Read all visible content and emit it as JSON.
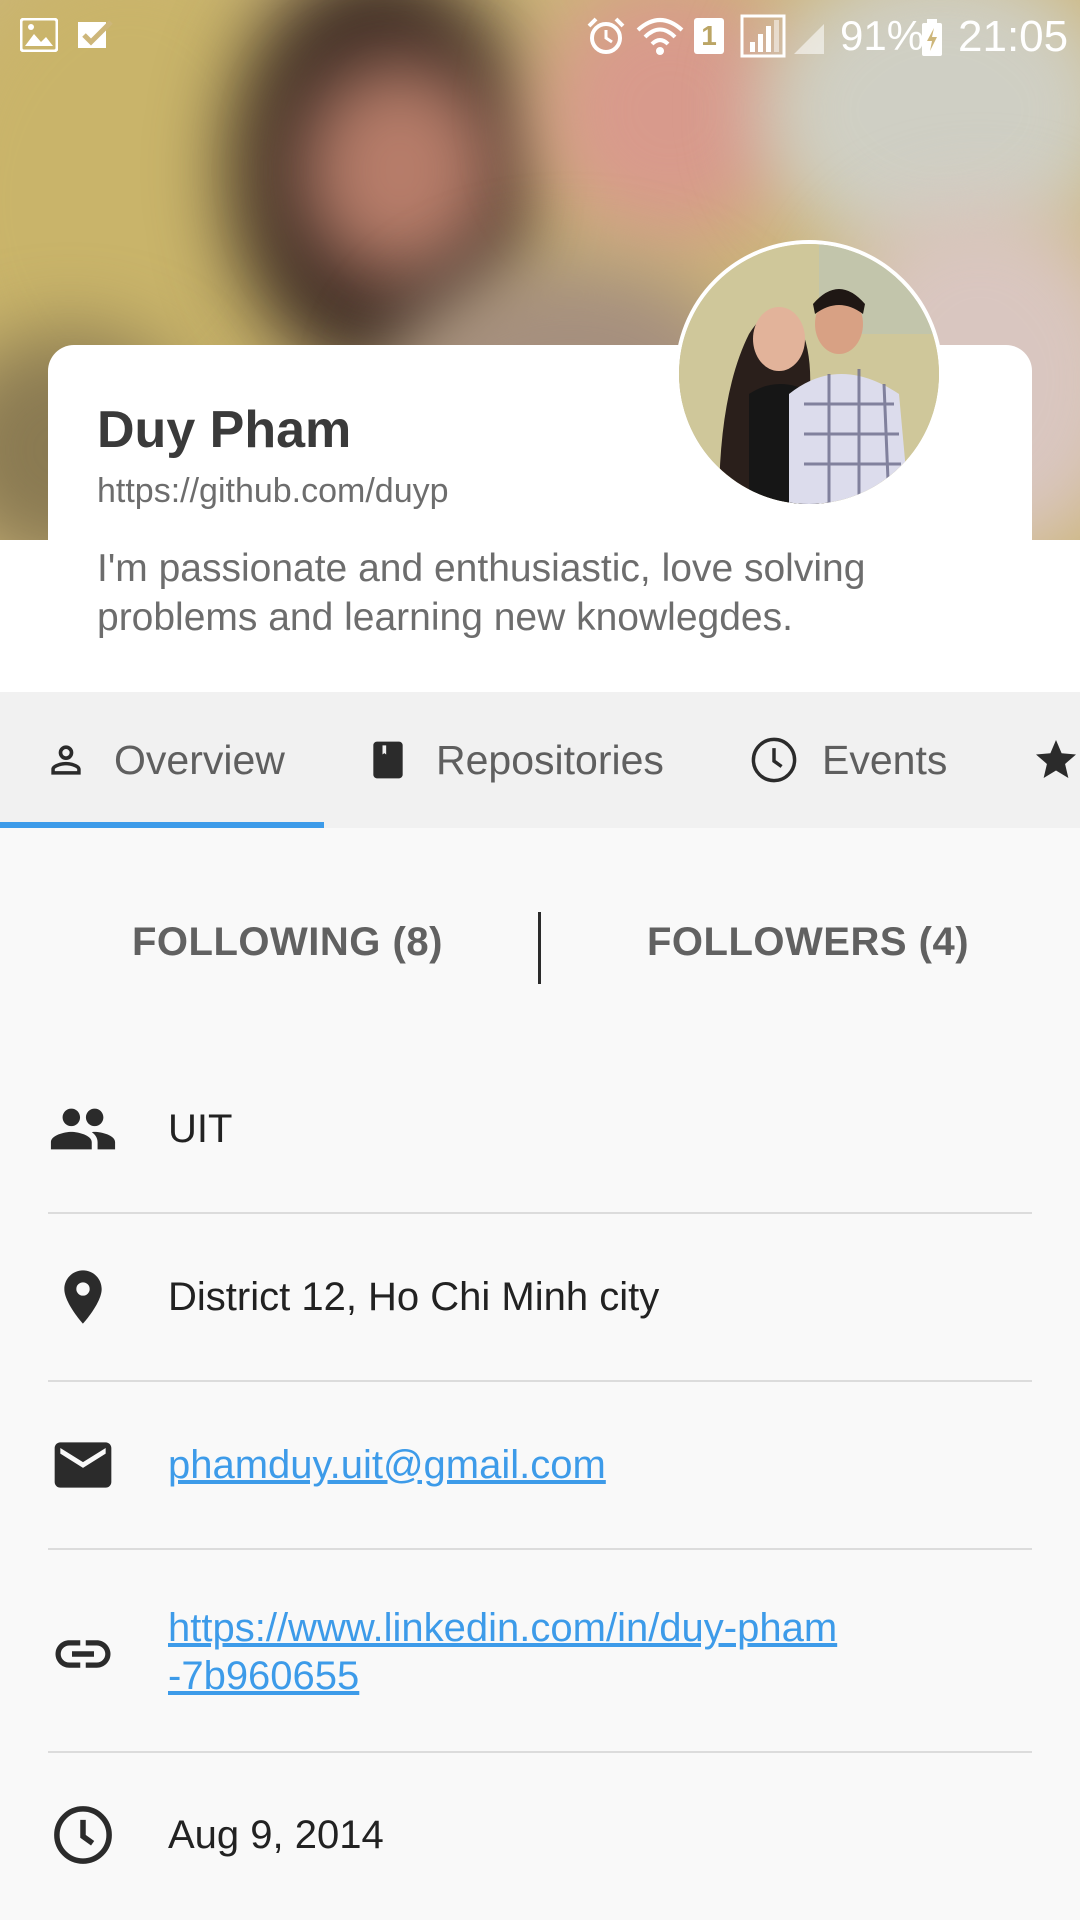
{
  "status_bar": {
    "battery": "91%",
    "time": "21:05",
    "sim_badge": "1"
  },
  "profile": {
    "name": "Duy Pham",
    "url": "https://github.com/duyp",
    "bio": "I'm passionate and enthusiastic, love solving problems and learning new knowlegdes."
  },
  "tabs": [
    {
      "label": "Overview",
      "icon": "person-icon",
      "selected": true
    },
    {
      "label": "Repositories",
      "icon": "book-icon",
      "selected": false
    },
    {
      "label": "Events",
      "icon": "clock-icon",
      "selected": false
    },
    {
      "label": "",
      "icon": "star-icon",
      "selected": false
    }
  ],
  "follow": {
    "following": "FOLLOWING (8)",
    "followers": "FOLLOWERS (4)"
  },
  "info": {
    "company": "UIT",
    "location": "District 12, Ho Chi Minh city",
    "email": "phamduy.uit@gmail.com",
    "website_line1": "https://www.linkedin.com/in/duy-pham",
    "website_line2": "-7b960655",
    "joined": "Aug 9, 2014"
  },
  "colors": {
    "accent": "#3d9be9",
    "text_primary": "#222222",
    "text_secondary": "#6d6d6d",
    "tab_background": "#f1f1f1",
    "page_background": "#f9f9f9"
  }
}
